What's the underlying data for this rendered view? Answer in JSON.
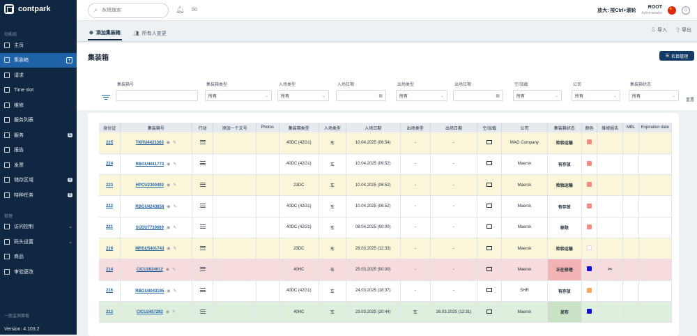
{
  "app": {
    "logo_text": "contpark"
  },
  "sidebar": {
    "section1": "功能组",
    "items": [
      {
        "label": "主页",
        "icon": "bar-chart-icon"
      },
      {
        "label": "集装箱",
        "icon": "container-icon",
        "active": true
      },
      {
        "label": "请求",
        "icon": "gear-icon"
      },
      {
        "label": "Time slot",
        "icon": "clock-icon"
      },
      {
        "label": "维修",
        "icon": "wrench-icon"
      },
      {
        "label": "服务列表",
        "icon": "list-icon"
      },
      {
        "label": "服务",
        "icon": "tools-icon",
        "badge": "S"
      },
      {
        "label": "报告",
        "icon": "report-icon"
      },
      {
        "label": "发票",
        "icon": "invoice-icon"
      },
      {
        "label": "储存区域",
        "icon": "storage-icon",
        "badge": "0"
      },
      {
        "label": "特种任务",
        "icon": "task-icon",
        "badge": "0"
      }
    ],
    "section2": "管理",
    "items2": [
      {
        "label": "访问控制",
        "icon": "lock-icon"
      },
      {
        "label": "码头设置",
        "icon": "settings-icon"
      },
      {
        "label": "商品",
        "icon": "box-icon"
      },
      {
        "label": "审验更改",
        "icon": "edit-icon"
      }
    ],
    "footer_sub": "一般监测面板",
    "version": "Version: 4.103.2"
  },
  "topbar": {
    "search_placeholder": "系统搜索",
    "zoom_text": "放大: 按Ctrl+滚轮",
    "user_name": "ROOT",
    "user_role": "Administrator"
  },
  "tabs": [
    {
      "label": "添加集装箱",
      "active": true
    },
    {
      "label": "所有人变更",
      "active": false
    }
  ],
  "actions": {
    "import": "导入",
    "export": "导出"
  },
  "page_title": "集装箱",
  "columns_button": "栏目管理",
  "filters": {
    "f1": {
      "label": "集装箱号",
      "value": ""
    },
    "f2": {
      "label": "集装箱类型",
      "value": "所有"
    },
    "f3": {
      "label": "入场类型",
      "value": "所有"
    },
    "f4": {
      "label": "入场日期",
      "value": ""
    },
    "f5": {
      "label": "出场类型",
      "value": "所有"
    },
    "f6": {
      "label": "出场日期",
      "value": ""
    },
    "f7": {
      "label": "空/加载",
      "value": "所有"
    },
    "f8": {
      "label": "公司",
      "value": "所有"
    },
    "f9": {
      "label": "集装箱状态",
      "value": "所有"
    },
    "reset": "重置"
  },
  "table": {
    "headers": [
      "身份证",
      "集装箱号",
      "行动",
      "添加一个文号",
      "Photos",
      "集装箱类型",
      "入场类型",
      "入场日期",
      "出场类型",
      "出场日期",
      "空/加载",
      "公司",
      "集装箱状态",
      "颜色",
      "维修报告",
      "MBL",
      "Expiration date"
    ],
    "rows": [
      {
        "id": "225",
        "container": "TKRU4421363",
        "type": "40DC (42G1)",
        "in_type": "车",
        "in_date": "10.04.2025 (06:54)",
        "out_type": "-",
        "out_date": "-",
        "load": "full",
        "company": "MAG Company",
        "status": "检验运输",
        "color": "#f28b82",
        "tone": "yellow",
        "status_hl": ""
      },
      {
        "id": "224",
        "container": "RBGU4811773",
        "type": "40DC (42G1)",
        "in_type": "车",
        "in_date": "10.04.2025 (06:52)",
        "out_type": "-",
        "out_date": "-",
        "load": "full",
        "company": "Maersk",
        "status": "有存放",
        "color": "#f28b82",
        "tone": "white",
        "status_hl": ""
      },
      {
        "id": "223",
        "container": "HPCU2300493",
        "type": "23DC",
        "in_type": "车",
        "in_date": "10.04.2025 (06:52)",
        "out_type": "-",
        "out_date": "-",
        "load": "full",
        "company": "Maersk",
        "status": "检验运输",
        "color": "#f28b82",
        "tone": "yellow",
        "status_hl": ""
      },
      {
        "id": "222",
        "container": "RBGU4243858",
        "type": "40DC (42G1)",
        "in_type": "车",
        "in_date": "10.04.2025 (06:52)",
        "out_type": "-",
        "out_date": "-",
        "load": "full",
        "company": "Maersk",
        "status": "有存放",
        "color": "#f28b82",
        "tone": "white",
        "status_hl": ""
      },
      {
        "id": "221",
        "container": "SUDU7730669",
        "type": "40DC (42G1)",
        "in_type": "车",
        "in_date": "08.04.2025 (00:00)",
        "out_type": "-",
        "out_date": "-",
        "load": "empty",
        "company": "Maersk",
        "status": "移除",
        "color": "#f28b82",
        "tone": "white",
        "status_hl": ""
      },
      {
        "id": "219",
        "container": "MRSU5401743",
        "type": "23DC",
        "in_type": "车",
        "in_date": "28.03.2025 (12:33)",
        "out_type": "-",
        "out_date": "-",
        "load": "empty",
        "company": "Maersk",
        "status": "检验运输",
        "color": "#ffffff",
        "tone": "yellow",
        "status_hl": ""
      },
      {
        "id": "214",
        "container": "CICU2824612",
        "type": "40HC",
        "in_type": "车",
        "in_date": "25.03.2025 (00:00)",
        "out_type": "-",
        "out_date": "-",
        "load": "full",
        "company": "Maersk",
        "status": "正在修理",
        "color": "#1010d0",
        "tone": "red",
        "status_hl": "hl-red",
        "repair": "✂"
      },
      {
        "id": "216",
        "container": "RBGU4043195",
        "type": "40DC (42G1)",
        "in_type": "车",
        "in_date": "24.03.2025 (18:37)",
        "out_type": "-",
        "out_date": "-",
        "load": "empty",
        "company": "SHR",
        "status": "有存放",
        "color": "#f5a65b",
        "tone": "white",
        "status_hl": ""
      },
      {
        "id": "213",
        "container": "CICU2457292",
        "type": "40HC",
        "in_type": "车",
        "in_date": "23.03.2025 (20:44)",
        "out_type": "车",
        "out_date": "26.03.2025 (12:31)",
        "load": "full",
        "company": "Maersk",
        "status": "发布",
        "color": "#1010d0",
        "tone": "green",
        "status_hl": "hl-green"
      }
    ]
  }
}
